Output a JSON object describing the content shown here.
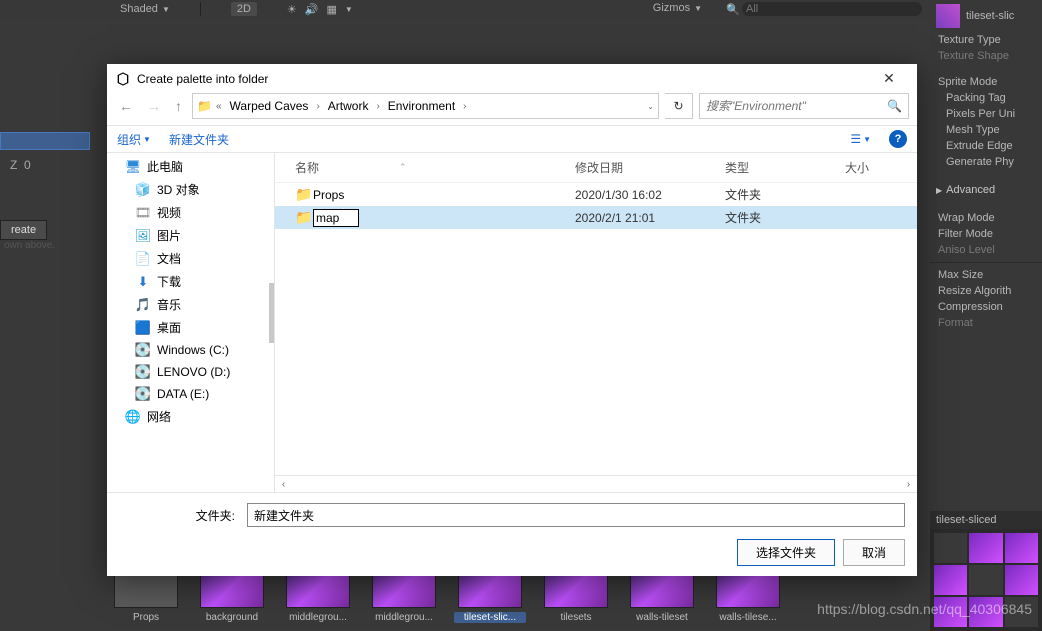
{
  "unity": {
    "toolbar": {
      "shading": "Shaded",
      "mode2d": "2D",
      "gizmos": "Gizmos",
      "search_placeholder": "All"
    },
    "left": {
      "z_label": "Z",
      "z_value": "0",
      "create": "reate",
      "shown": "own above."
    },
    "assets": [
      {
        "label": "Props",
        "folder": true
      },
      {
        "label": "background"
      },
      {
        "label": "middlegrou..."
      },
      {
        "label": "middlegrou..."
      },
      {
        "label": "tileset-slic...",
        "selected": true
      },
      {
        "label": "tilesets"
      },
      {
        "label": "walls-tileset"
      },
      {
        "label": "walls-tilese..."
      }
    ],
    "inspector": {
      "asset_name": "tileset-slic",
      "rows": [
        {
          "t": "Texture Type"
        },
        {
          "t": "Texture Shape",
          "dim": true
        },
        {
          "gap": true
        },
        {
          "t": "Sprite Mode"
        },
        {
          "t": "Packing Tag",
          "indent": true
        },
        {
          "t": "Pixels Per Uni",
          "indent": true
        },
        {
          "t": "Mesh Type",
          "indent": true
        },
        {
          "t": "Extrude Edge",
          "indent": true
        },
        {
          "t": "Generate Phy",
          "indent": true
        },
        {
          "gap": true
        },
        {
          "t": "Advanced",
          "section": true
        },
        {
          "gap": true
        },
        {
          "t": "Wrap Mode"
        },
        {
          "t": "Filter Mode"
        },
        {
          "t": "Aniso Level",
          "dim": true
        },
        {
          "hr": true
        },
        {
          "t": "Max Size"
        },
        {
          "t": "Resize Algorith"
        },
        {
          "t": "Compression"
        },
        {
          "t": "Format",
          "dim": true
        }
      ],
      "preview_title": "tileset-sliced"
    }
  },
  "dialog": {
    "title": "Create palette into folder",
    "close": "✕",
    "breadcrumbs": [
      "Warped Caves",
      "Artwork",
      "Environment"
    ],
    "search_placeholder": "搜索\"Environment\"",
    "toolbar": {
      "organize": "组织",
      "newfolder": "新建文件夹"
    },
    "sidebar": [
      {
        "icon": "pc",
        "label": "此电脑"
      },
      {
        "icon": "3d",
        "label": "3D 对象",
        "indent": true
      },
      {
        "icon": "vid",
        "label": "视频",
        "indent": true
      },
      {
        "icon": "pic",
        "label": "图片",
        "indent": true
      },
      {
        "icon": "doc",
        "label": "文档",
        "indent": true
      },
      {
        "icon": "dl",
        "label": "下载",
        "indent": true
      },
      {
        "icon": "music",
        "label": "音乐",
        "indent": true
      },
      {
        "icon": "desk",
        "label": "桌面",
        "indent": true
      },
      {
        "icon": "drv",
        "label": "Windows (C:)",
        "indent": true
      },
      {
        "icon": "drv",
        "label": "LENOVO (D:)",
        "indent": true
      },
      {
        "icon": "drv",
        "label": "DATA (E:)",
        "indent": true
      },
      {
        "icon": "net",
        "label": "网络"
      }
    ],
    "columns": {
      "name": "名称",
      "date": "修改日期",
      "type": "类型",
      "size": "大小"
    },
    "rows": [
      {
        "name": "Props",
        "date": "2020/1/30 16:02",
        "type": "文件夹",
        "edit": false,
        "selected": false
      },
      {
        "name": "map",
        "date": "2020/2/1 21:01",
        "type": "文件夹",
        "edit": true,
        "selected": true
      }
    ],
    "footer": {
      "label": "文件夹:",
      "value": "新建文件夹",
      "select": "选择文件夹",
      "cancel": "取消"
    }
  },
  "watermark": "https://blog.csdn.net/qq_40306845"
}
